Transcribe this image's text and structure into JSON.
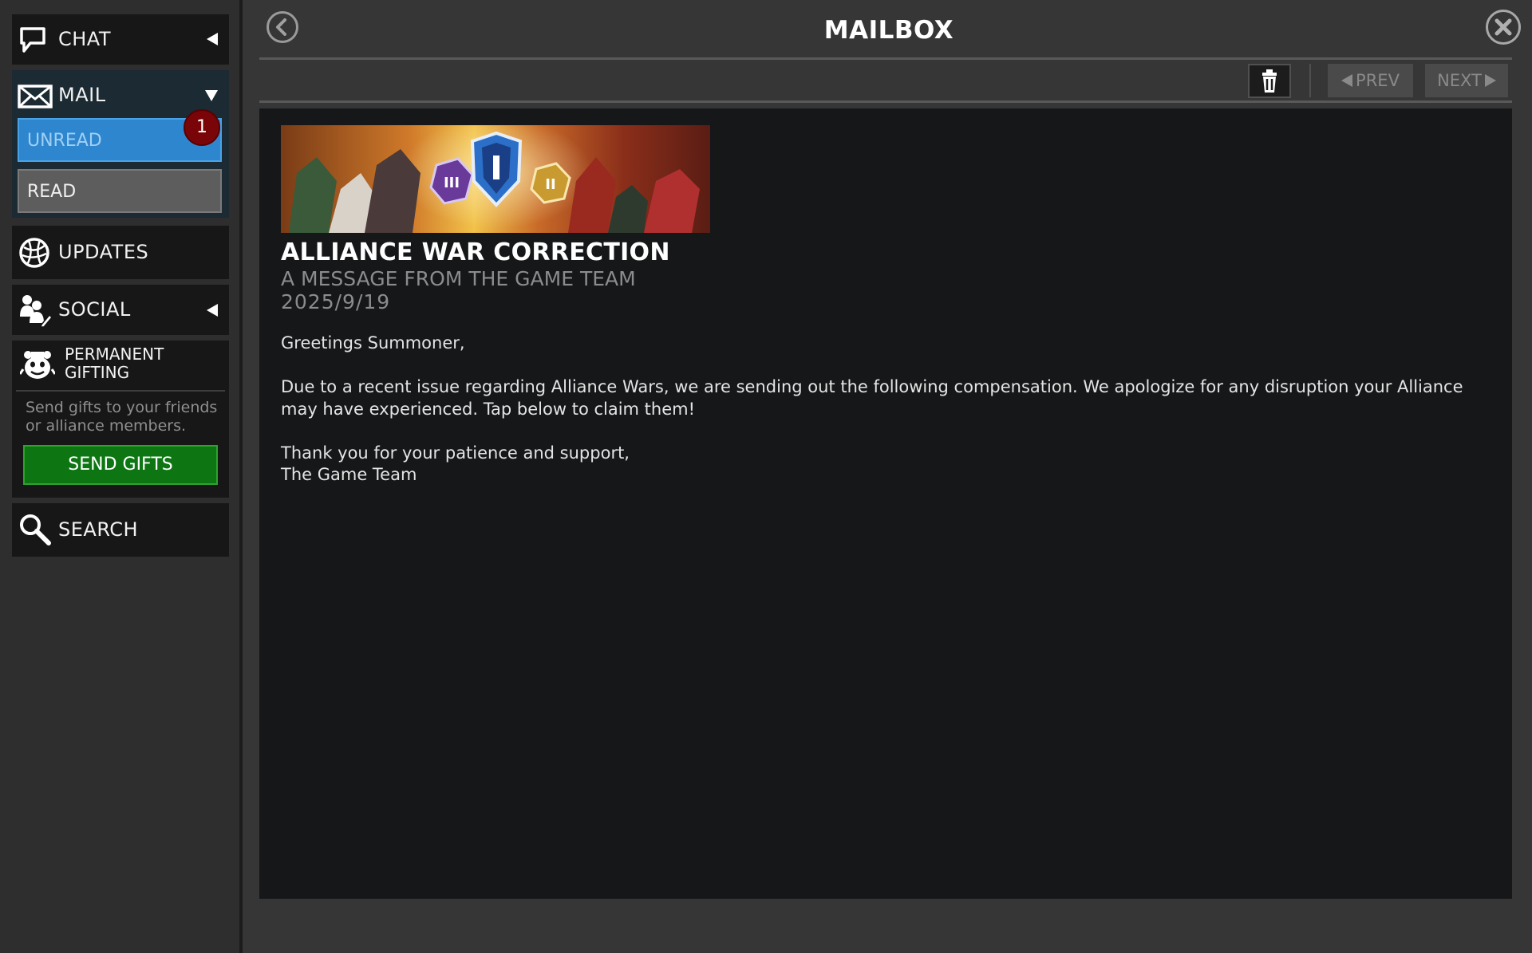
{
  "sidebar": {
    "chat": {
      "label": "CHAT",
      "icon": "chat-bubble-icon"
    },
    "mail": {
      "label": "MAIL",
      "icon": "envelope-icon",
      "unread_label": "UNREAD",
      "unread_count": "1",
      "read_label": "READ"
    },
    "updates": {
      "label": "UPDATES",
      "icon": "globe-icon"
    },
    "social": {
      "label": "SOCIAL",
      "icon": "people-icon"
    },
    "gifting": {
      "title": "PERMANENT GIFTING",
      "icon": "gift-mascot-icon",
      "description": "Send gifts to your friends or alliance members.",
      "button_label": "SEND GIFTS"
    },
    "search": {
      "label": "SEARCH",
      "icon": "search-icon"
    }
  },
  "header": {
    "title": "MAILBOX",
    "back_icon": "chevron-left-icon",
    "close_icon": "close-icon"
  },
  "toolbar": {
    "trash_icon": "trash-icon",
    "prev_label": "PREV",
    "next_label": "NEXT"
  },
  "message": {
    "title": "ALLIANCE WAR CORRECTION",
    "subtitle": "A MESSAGE FROM THE GAME TEAM",
    "date": "2025/9/19",
    "greeting": "Greetings Summoner,",
    "paragraph": "Due to a recent issue regarding Alliance Wars, we are sending out the following compensation. We apologize for any disruption your Alliance may have experienced. Tap below to claim them!",
    "closing_line1": "Thank you for your patience and support,",
    "closing_line2": "The Game Team"
  },
  "colors": {
    "unread_blue": "#2e86cf",
    "send_green": "#0d7612",
    "badge_red": "#7a0508"
  }
}
